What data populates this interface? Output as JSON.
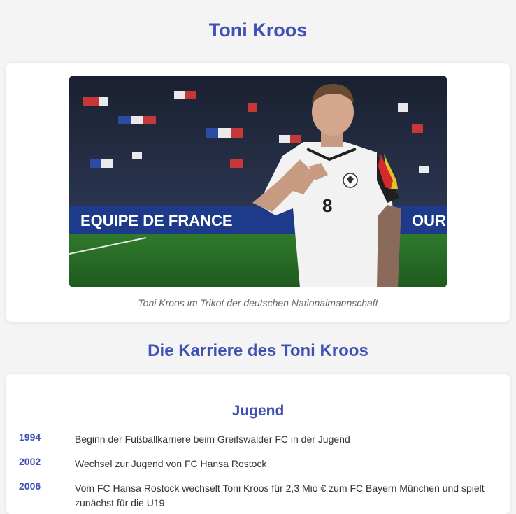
{
  "page": {
    "title": "Toni Kroos"
  },
  "photo": {
    "caption": "Toni Kroos im Trikot der deutschen Nationalmannschaft",
    "banner_text_left": "EQUIPE DE FRANCE",
    "banner_text_right": "OUR V",
    "shirt_number": "8"
  },
  "career": {
    "title": "Die Karriere des Toni Kroos",
    "section": {
      "title": "Jugend",
      "entries": [
        {
          "year": "1994",
          "text": "Beginn der Fußballkarriere beim Greifswalder FC in der Jugend"
        },
        {
          "year": "2002",
          "text": "Wechsel zur Jugend von FC Hansa Rostock"
        },
        {
          "year": "2006",
          "text": "Vom FC Hansa Rostock wechselt Toni Kroos für 2,3 Mio € zum FC Bayern München und spielt zunächst für die U19"
        }
      ]
    }
  },
  "colors": {
    "accent": "#3f51b5",
    "background": "#f4f4f4",
    "card": "#ffffff"
  }
}
